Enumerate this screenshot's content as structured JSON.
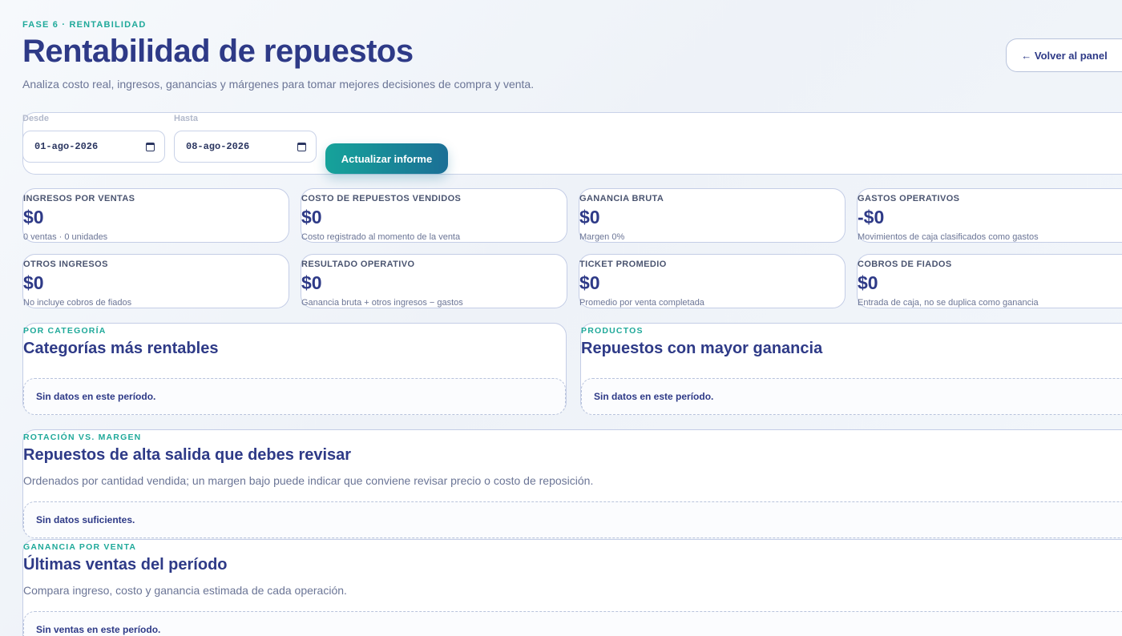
{
  "header": {
    "eyebrow": "FASE 6 · RENTABILIDAD",
    "title": "Rentabilidad de repuestos",
    "subtitle": "Analiza costo real, ingresos, ganancias y márgenes para tomar mejores decisiones de compra y venta.",
    "back_label": "← Volver al panel"
  },
  "filters": {
    "from_label": "Desde",
    "from_value": "01-ago-2026",
    "to_label": "Hasta",
    "to_value": "08-ago-2026",
    "update_label": "Actualizar informe"
  },
  "stats": [
    {
      "label": "INGRESOS POR VENTAS",
      "value": "$0",
      "note": "0 ventas · 0 unidades"
    },
    {
      "label": "COSTO DE REPUESTOS VENDIDOS",
      "value": "$0",
      "note": "Costo registrado al momento de la venta"
    },
    {
      "label": "GANANCIA BRUTA",
      "value": "$0",
      "note": "Margen 0%"
    },
    {
      "label": "GASTOS OPERATIVOS",
      "value": "-$0",
      "note": "Movimientos de caja clasificados como gastos"
    },
    {
      "label": "OTROS INGRESOS",
      "value": "$0",
      "note": "No incluye cobros de fiados"
    },
    {
      "label": "RESULTADO OPERATIVO",
      "value": "$0",
      "note": "Ganancia bruta + otros ingresos − gastos"
    },
    {
      "label": "TICKET PROMEDIO",
      "value": "$0",
      "note": "Promedio por venta completada"
    },
    {
      "label": "COBROS DE FIADOS",
      "value": "$0",
      "note": "Entrada de caja, no se duplica como ganancia"
    }
  ],
  "panels": {
    "categories": {
      "eyebrow": "POR CATEGORÍA",
      "title": "Categorías más rentables",
      "empty": "Sin datos en este período."
    },
    "products": {
      "eyebrow": "PRODUCTOS",
      "title": "Repuestos con mayor ganancia",
      "empty": "Sin datos en este período."
    },
    "rotation": {
      "eyebrow": "ROTACIÓN VS. MARGEN",
      "title": "Repuestos de alta salida que debes revisar",
      "desc": "Ordenados por cantidad vendida; un margen bajo puede indicar que conviene revisar precio o costo de reposición.",
      "empty": "Sin datos suficientes."
    },
    "sales": {
      "eyebrow": "GANANCIA POR VENTA",
      "title": "Últimas ventas del período",
      "desc": "Compara ingreso, costo y ganancia estimada de cada operación.",
      "empty": "Sin ventas en este período."
    }
  }
}
